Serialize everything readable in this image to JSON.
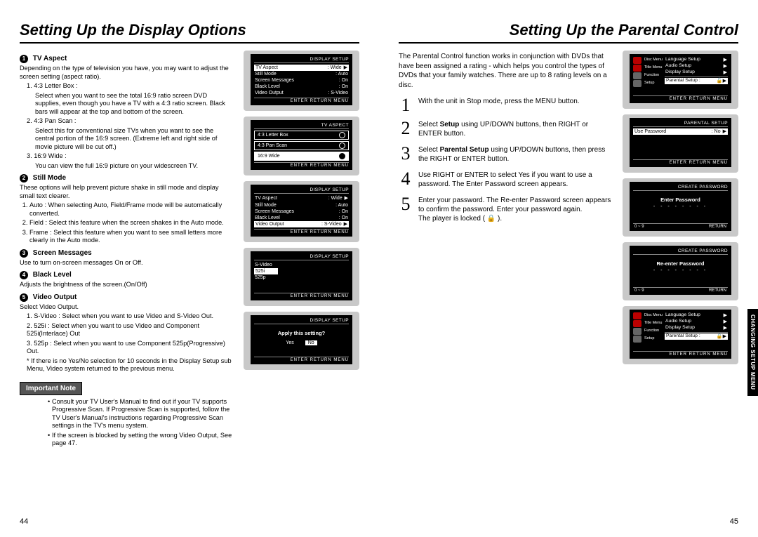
{
  "left": {
    "title": "Setting Up the Display Options",
    "items": {
      "1": {
        "head": "TV Aspect",
        "intro": "Depending on the type of television you have, you may want to adjust the screen setting (aspect ratio).",
        "opt1_label": "1. 4:3 Letter Box :",
        "opt1_body": "Select when you want to see the total 16:9 ratio screen DVD supplies, even though you have a TV with a 4:3 ratio screen. Black bars will appear at the top and bottom of the screen.",
        "opt2_label": "2. 4:3 Pan Scan :",
        "opt2_body": "Select this for conventional size TVs when you want to see the central portion of the 16:9 screen. (Extreme left and right side of movie picture will be cut off.)",
        "opt3_label": "3. 16:9 Wide :",
        "opt3_body": "You can view the full 16:9 picture on your widescreen TV."
      },
      "2": {
        "head": "Still Mode",
        "intro": "These options will help prevent picture shake in still mode and display small text clearer.",
        "opt1": "Auto : When selecting Auto, Field/Frame mode will be automatically converted.",
        "opt2": "Field : Select this feature when the screen shakes in the Auto mode.",
        "opt3": "Frame : Select this feature when you want to see small letters more clearly in the Auto mode."
      },
      "3": {
        "head": "Screen Messages",
        "body": "Use to turn on-screen messages On or Off."
      },
      "4": {
        "head": "Black Level",
        "body": "Adjusts the brightness of the screen.(On/Off)"
      },
      "5": {
        "head": "Video Output",
        "intro": "Select Video Output.",
        "opt1": "1. S-Video : Select when you want to use Video and S-Video Out.",
        "opt2": "2. 525i : Select when you want to use Video and Component 525i(Interlace) Out",
        "opt3": "3. 525p : Select when you want to use Component 525p(Progressive) Out.",
        "note": "* If there is no Yes/No selection for 10 seconds in the Display Setup sub Menu, Video system returned to the previous menu."
      }
    },
    "important_label": "Important Note",
    "fine": {
      "a": "Consult your TV User's Manual to find out if your TV supports Progressive Scan. If Progressive Scan is supported, follow the TV User's Manual's instructions regarding Progressive Scan settings in the TV's menu system.",
      "b": "If the screen is blocked by setting the wrong Video Output, See page 47."
    },
    "screens": {
      "hdr_display": "DISPLAY SETUP",
      "hdr_tvaspect": "TV ASPECT",
      "ftr": "ENTER   RETURN   MENU",
      "rows": {
        "tv_aspect": "TV Aspect",
        "still_mode": "Still Mode",
        "screen_msgs": "Screen Messages",
        "black_level": "Black Level",
        "video_output": "Video Output"
      },
      "vals": {
        "wide": "Wide",
        "auto": "Auto",
        "on": "On",
        "svideo": "S-Video"
      },
      "aspect_opts": {
        "a": "4:3 Letter Box",
        "b": "4:3 Pan Scan",
        "c": "16:9 Wide"
      },
      "video_opts": {
        "a": "S-Video",
        "b": "525i",
        "c": "525p"
      },
      "apply_q": "Apply this setting?",
      "yes": "Yes",
      "no": "No"
    },
    "pagenum": "44"
  },
  "right": {
    "title": "Setting Up the Parental Control",
    "intro": "The Parental Control function works in conjunction with DVDs that have been assigned a rating - which helps you control the types of DVDs that your family watches. There are up to 8 rating levels on a disc.",
    "steps": {
      "1": "With the unit in Stop mode, press the MENU button.",
      "2a": "Select ",
      "2b": "Setup",
      "2c": " using UP/DOWN buttons, then RIGHT or ENTER button.",
      "3a": "Select ",
      "3b": "Parental Setup",
      "3c": " using UP/DOWN buttons, then press the RIGHT or ENTER button.",
      "4": "Use RIGHT or ENTER to select Yes if you want to use a password. The Enter Password screen appears.",
      "5a": "Enter your password. The Re-enter Password screen appears to confirm the password. Enter your password again.",
      "5b": "The player is locked ( 🔒 )."
    },
    "screens": {
      "hdr_parental": "PARENTAL SETUP",
      "hdr_create": "CREATE PASSWORD",
      "menu": {
        "disc": "Disc Menu",
        "title": "Title Menu",
        "function": "Function",
        "setup": "Setup",
        "lang": "Language Setup",
        "audio": "Audio Setup",
        "display": "Display Setup",
        "parental": "Parental Setup :"
      },
      "use_pw": "Use Password",
      "use_pw_val": "No",
      "enter_pw": "Enter Password",
      "reenter_pw": "Re-enter Password",
      "dashes": "- -   - -   - -   - -",
      "zero_nine_l": "0",
      "zero_nine_r": "9",
      "return": "RETURN",
      "ftr": "ENTER   RETURN   MENU"
    },
    "sidetab": "CHANGING SETUP MENU",
    "pagenum": "45"
  }
}
